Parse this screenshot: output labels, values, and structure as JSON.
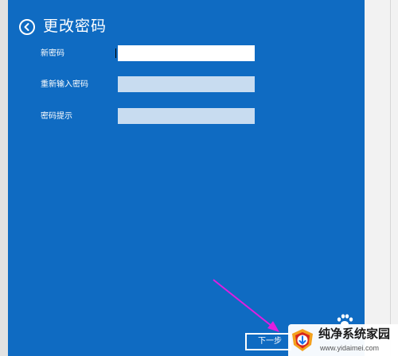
{
  "dialog": {
    "title": "更改密码",
    "back_icon": "back-arrow-circle-icon",
    "background_color": "#0f6bc2"
  },
  "form": {
    "new_password_label": "新密码",
    "new_password_value": "",
    "confirm_password_label": "重新输入密码",
    "confirm_password_value": "",
    "hint_label": "密码提示",
    "hint_value": ""
  },
  "footer": {
    "next_label": "下一步",
    "paw_icon": "paw-icon"
  },
  "annotation": {
    "arrow_color": "#e01ee0",
    "arrow_icon": "pointer-arrow"
  },
  "watermark": {
    "name": "纯净系统家园",
    "url": "www.yidaimei.com",
    "logo_icon": "shield-logo-icon"
  }
}
